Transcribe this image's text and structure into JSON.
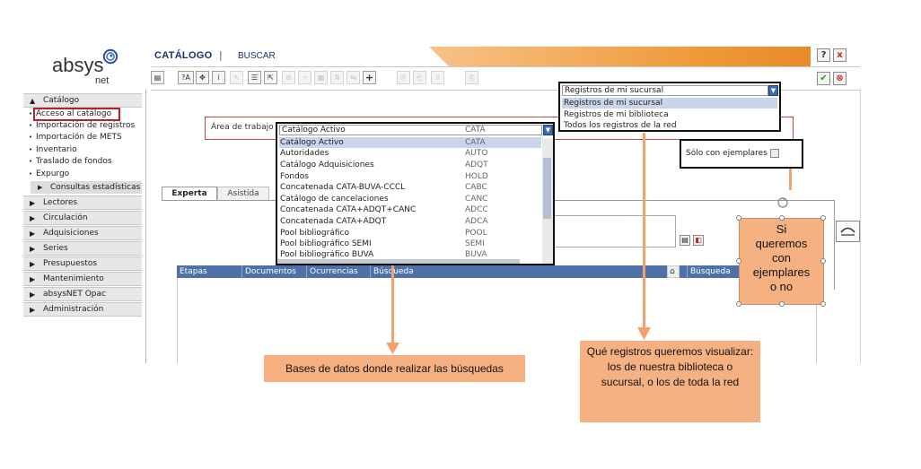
{
  "logo": {
    "word": "absys",
    "suffix": "net"
  },
  "header": {
    "title": "CATÁLOGO",
    "separator": "|",
    "action": "BUSCAR",
    "help_label": "?",
    "close_label": "x"
  },
  "colors": {
    "accent": "#ef9a3a",
    "nav_blue": "#1b2f6b",
    "annotation": "#f6b183",
    "highlight_border": "#b91f26"
  },
  "sidebar": {
    "catalogo": "Catálogo",
    "catalogo_items": [
      "Acceso al catálogo",
      "Importación de registros",
      "Importación de METS",
      "Inventario",
      "Traslado de fondos",
      "Expurgo"
    ],
    "consultas": "Consultas estadísticas",
    "modules": [
      "Lectores",
      "Circulación",
      "Adquisiciones",
      "Series",
      "Presupuestos",
      "Mantenimiento",
      "absysNET Opac",
      "Administración"
    ]
  },
  "toolbar": {
    "plus_label": "+",
    "ta_label": "?A",
    "info_label": "i"
  },
  "work_area": {
    "label": "Área de trabajo",
    "selected": {
      "name": "Catálogo Activo",
      "code": "CATA"
    },
    "options": [
      {
        "name": "Catálogo Activo",
        "code": "CATA"
      },
      {
        "name": "Autoridades",
        "code": "AUTO"
      },
      {
        "name": "Catálogo Adquisiciones",
        "code": "ADQT"
      },
      {
        "name": "Fondos",
        "code": "HOLD"
      },
      {
        "name": "Concatenada CATA-BUVA-CCCL",
        "code": "CABC"
      },
      {
        "name": "Catálogo de cancelaciones",
        "code": "CANC"
      },
      {
        "name": "Concatenada CATA+ADQT+CANC",
        "code": "ADCC"
      },
      {
        "name": "Concatenada CATA+ADQT",
        "code": "ADCA"
      },
      {
        "name": "Pool bibliográfico",
        "code": "POOL"
      },
      {
        "name": "Pool bibliográfico SEMI",
        "code": "SEMI"
      },
      {
        "name": "Pool bibliográfico BUVA",
        "code": "BUVA"
      }
    ]
  },
  "records": {
    "selected": "Registros de mi sucursal",
    "options": [
      "Registros de mi sucursal",
      "Registros de mi biblioteca",
      "Todos los registros de la red"
    ]
  },
  "only_with_copies": {
    "label": "Sólo con ejemplares",
    "checked": false
  },
  "tabs": [
    "Experta",
    "Asistida"
  ],
  "results_header": [
    "Etapas",
    "Documentos",
    "Ocurrencias",
    "Búsqueda",
    "Búsqueda re"
  ],
  "annotations": {
    "si": [
      "Si",
      "queremos",
      "con",
      "ejemplares",
      "o no"
    ],
    "bases": "Bases de datos donde realizar las búsquedas",
    "registros": "Qué registros queremos visualizar: los de nuestra biblioteca o sucursal, o los de toda la red"
  }
}
